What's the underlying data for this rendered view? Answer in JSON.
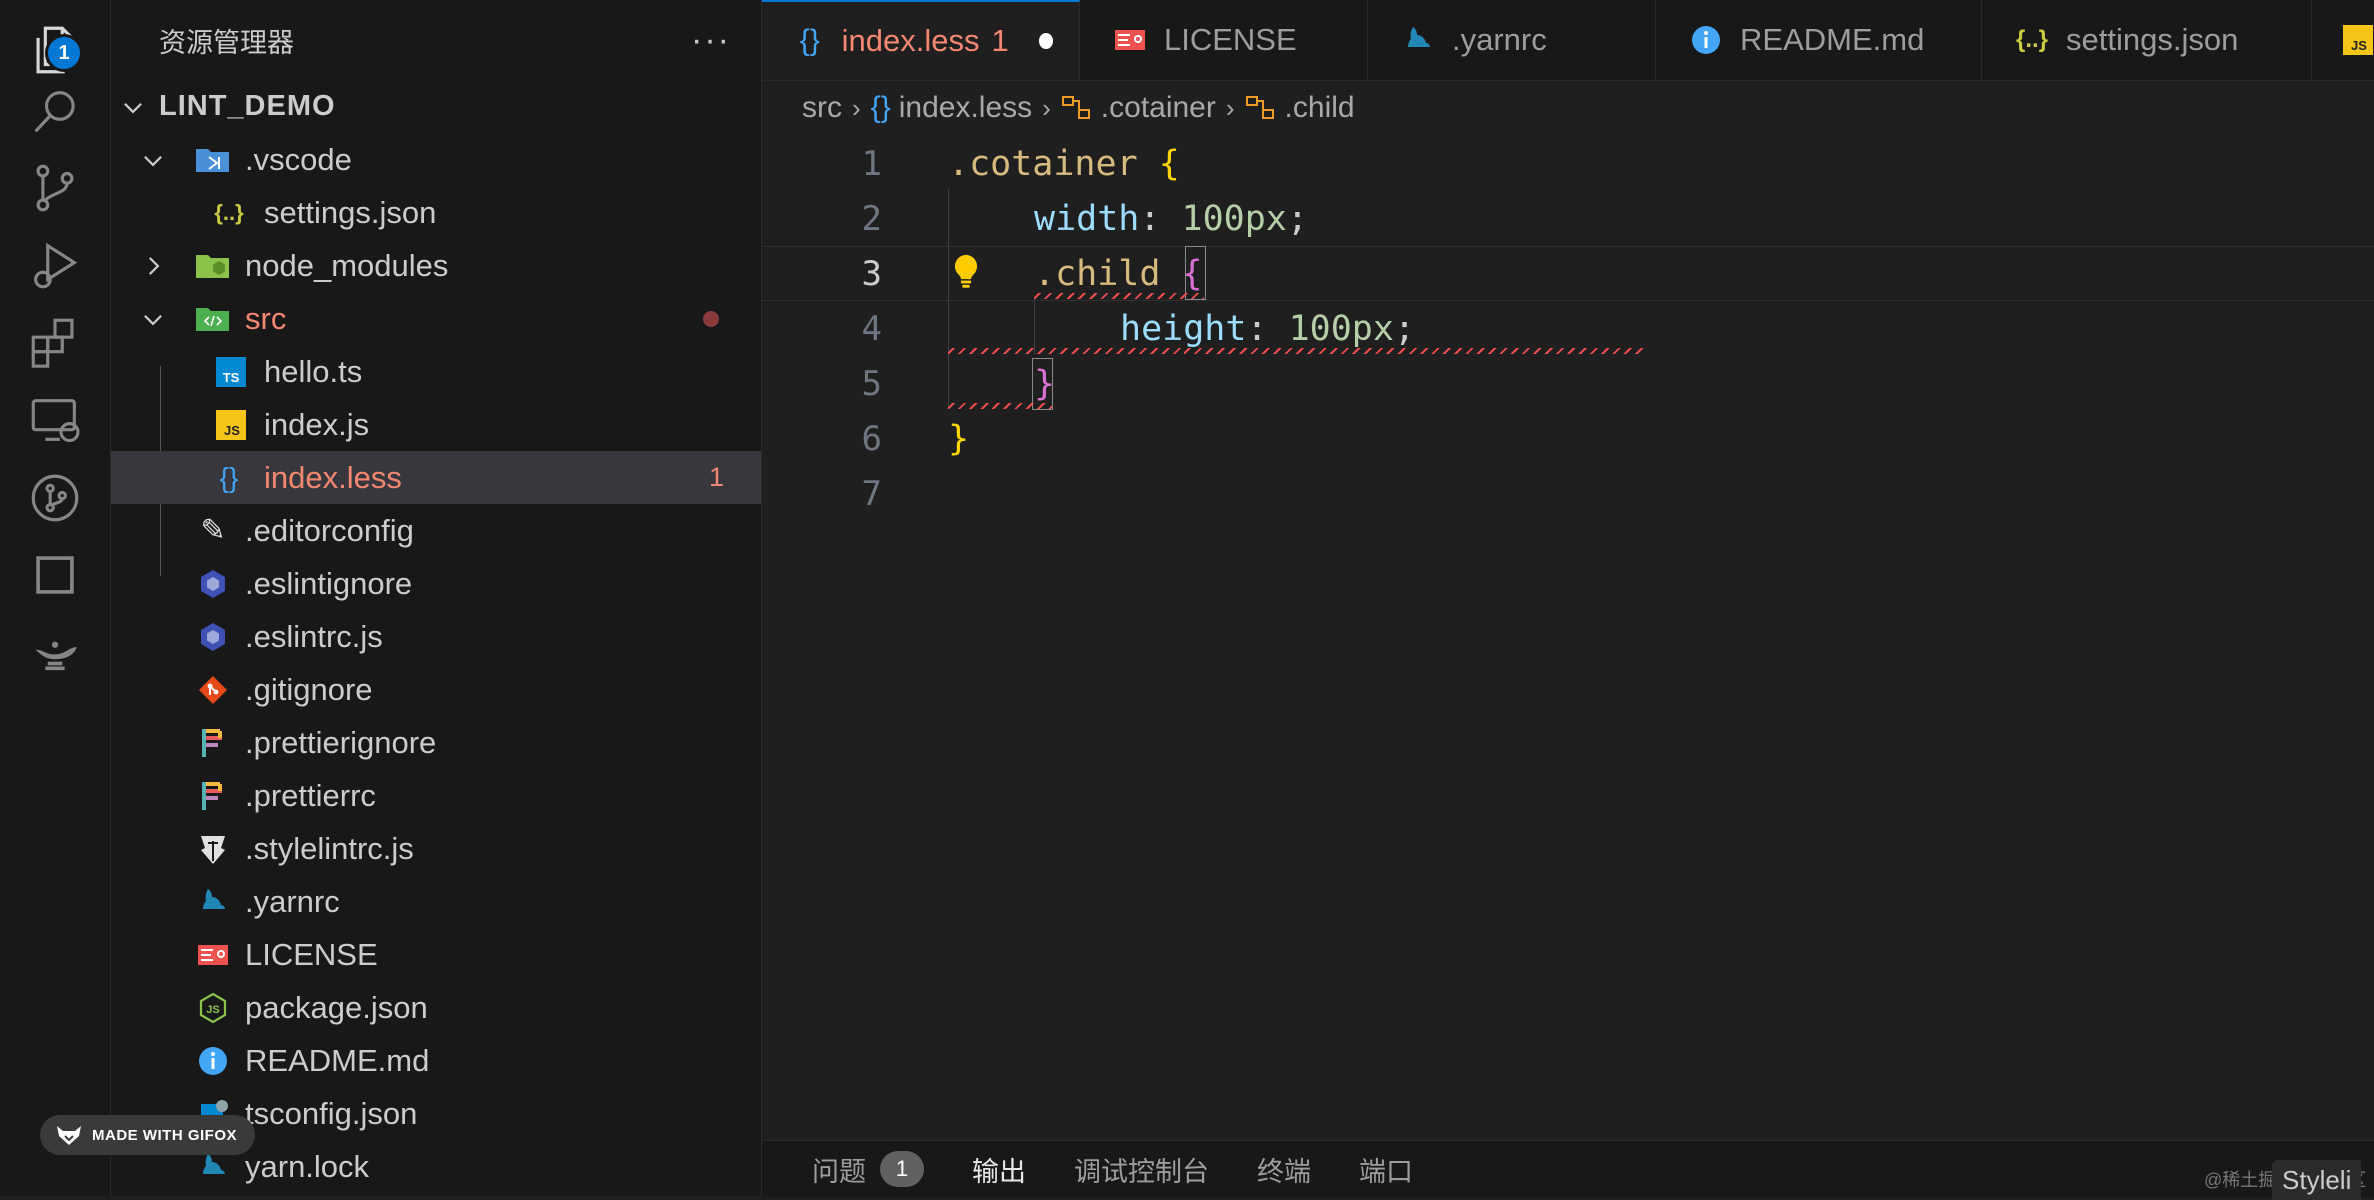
{
  "activity_bar": {
    "explorer_badge": "1",
    "items": [
      "explorer",
      "search",
      "source-control",
      "run-debug",
      "extensions",
      "remote-explorer",
      "git-graph",
      "square",
      "genie"
    ]
  },
  "gifox_badge": "MADE WITH GIFOX",
  "sidebar": {
    "title": "资源管理器",
    "more": "···",
    "root": "LINT_DEMO",
    "rows": [
      {
        "label": ".vscode",
        "type": "folder-open"
      },
      {
        "label": "settings.json",
        "type": "json"
      },
      {
        "label": "node_modules",
        "type": "folder-closed"
      },
      {
        "label": "src",
        "type": "folder-open"
      },
      {
        "label": "hello.ts",
        "type": "ts"
      },
      {
        "label": "index.js",
        "type": "js"
      },
      {
        "label": "index.less",
        "type": "less",
        "count": "1"
      },
      {
        "label": ".editorconfig",
        "type": "editorconfig"
      },
      {
        "label": ".eslintignore",
        "type": "eslint"
      },
      {
        "label": ".eslintrc.js",
        "type": "eslint"
      },
      {
        "label": ".gitignore",
        "type": "git"
      },
      {
        "label": ".prettierignore",
        "type": "prettier"
      },
      {
        "label": ".prettierrc",
        "type": "prettier"
      },
      {
        "label": ".stylelintrc.js",
        "type": "stylelint"
      },
      {
        "label": ".yarnrc",
        "type": "yarn"
      },
      {
        "label": "LICENSE",
        "type": "license"
      },
      {
        "label": "package.json",
        "type": "node"
      },
      {
        "label": "README.md",
        "type": "info"
      },
      {
        "label": "tsconfig.json",
        "type": "tsconfig"
      },
      {
        "label": "yarn.lock",
        "type": "yarn"
      }
    ]
  },
  "tabs": [
    {
      "label": "index.less",
      "count": "1",
      "active": true
    },
    {
      "label": "LICENSE"
    },
    {
      "label": ".yarnrc"
    },
    {
      "label": "README.md"
    },
    {
      "label": "settings.json"
    },
    {
      "label": "JS"
    }
  ],
  "breadcrumb": [
    "src",
    "index.less",
    ".cotainer",
    ".child"
  ],
  "code": {
    "line_numbers": [
      "1",
      "2",
      "3",
      "4",
      "5",
      "6",
      "7"
    ],
    "current_line": "3",
    "lines": [
      {
        "selector": ".cotainer",
        "brace": "{"
      },
      {
        "prop": "width",
        "colon": ":",
        "value": "100px",
        "semi": ";"
      },
      {
        "selector": ".child",
        "brace": "{"
      },
      {
        "prop": "height",
        "colon": ":",
        "value": "100px",
        "semi": ";"
      },
      {
        "brace": "}"
      },
      {
        "brace": "}"
      }
    ]
  },
  "panel": {
    "tabs": [
      {
        "label": "问题",
        "badge": "1"
      },
      {
        "label": "输出",
        "active": true
      },
      {
        "label": "调试控制台"
      },
      {
        "label": "终端"
      },
      {
        "label": "端口"
      }
    ]
  },
  "watermark": "@稀土掘金技术社区",
  "status_tag": "Styleli"
}
